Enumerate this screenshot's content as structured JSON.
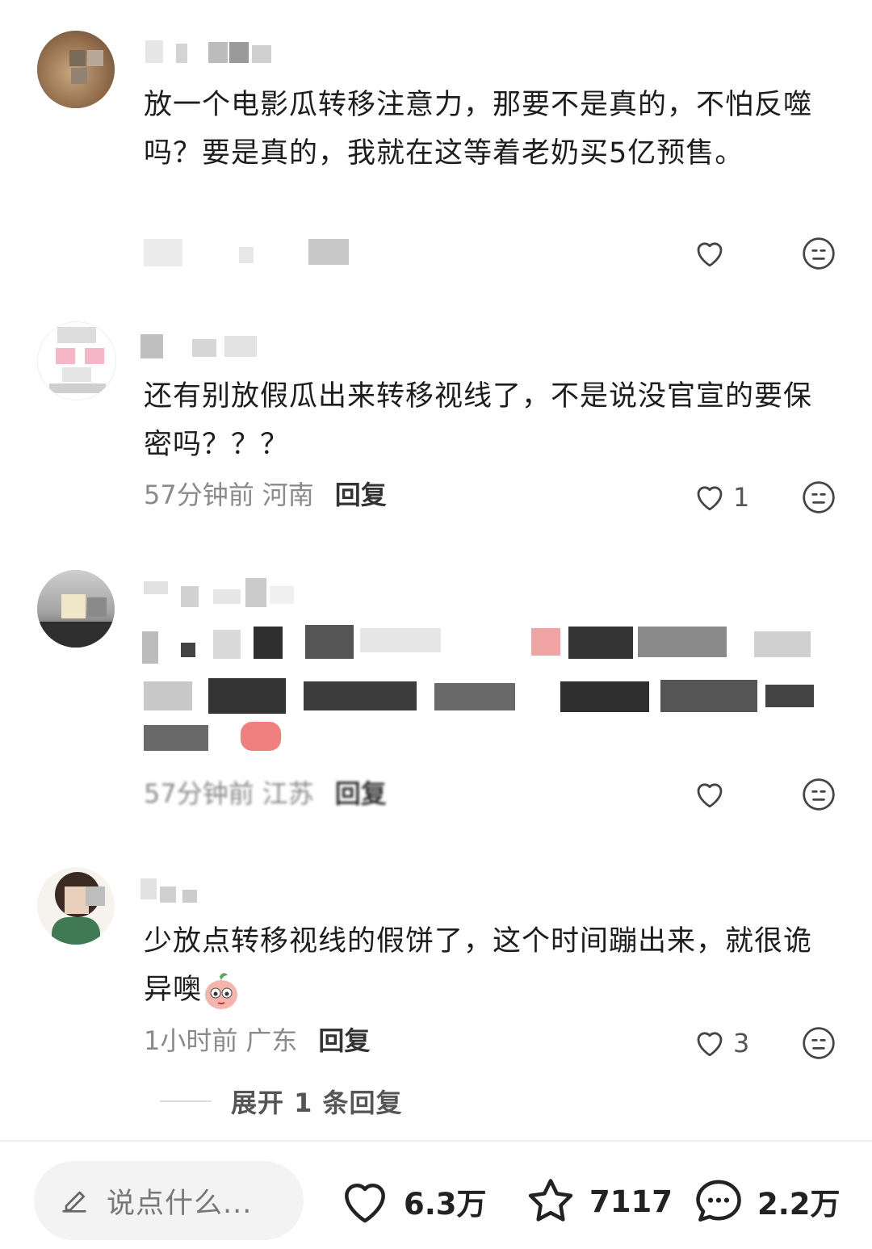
{
  "comments": [
    {
      "id": "c1",
      "username": "",
      "body": "放一个电影瓜转移注意力，那要不是真的，不怕反噬吗？要是真的，我就在这等着老奶买5亿预售。",
      "time": "",
      "location": "",
      "reply_label": "",
      "like_count": ""
    },
    {
      "id": "c2",
      "username": "",
      "body": "还有别放假瓜出来转移视线了，不是说没官宣的要保密吗？？？",
      "time": "57分钟前",
      "location": "河南",
      "reply_label": "回复",
      "like_count": "1"
    },
    {
      "id": "c3",
      "username": "",
      "body": "",
      "time": "57分钟前",
      "location": "江苏",
      "reply_label": "回复",
      "like_count": ""
    },
    {
      "id": "c4",
      "username": "",
      "body": "少放点转移视线的假饼了，这个时间蹦出来，就很诡异噢",
      "time": "1小时前",
      "location": "广东",
      "reply_label": "回复",
      "like_count": "3"
    }
  ],
  "expand_replies": "展开 1 条回复",
  "bottom_bar": {
    "input_placeholder": "说点什么...",
    "likes": "6.3万",
    "favorites": "7117",
    "comments": "2.2万"
  },
  "icons": {
    "like": "heart-outline-icon",
    "dislike": "neutral-face-icon",
    "input": "pencil-icon",
    "favorite": "star-outline-icon",
    "comment": "speech-bubble-icon"
  },
  "colors": {
    "text": "#1d1d1d",
    "meta": "#8a8a8a",
    "icon": "#444444",
    "input_bg": "#f3f3f3"
  }
}
